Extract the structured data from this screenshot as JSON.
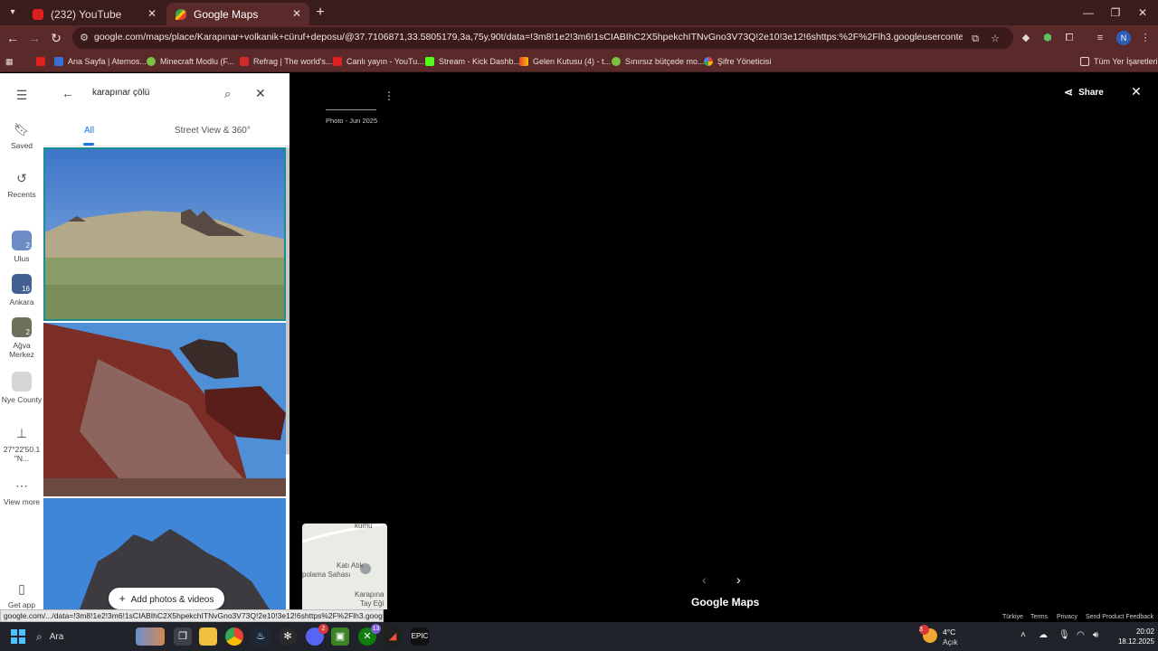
{
  "browser": {
    "tabs": [
      {
        "title": "(232) YouTube",
        "active": false
      },
      {
        "title": "Google Maps",
        "active": true
      }
    ],
    "url": "google.com/maps/place/Karapınar+volkanik+cüruf+deposu/@37.7106871,33.5805179,3a,75y,90t/data=!3m8!1e2!3m6!1sCIABIhC2X5hpekchITNvGno3V73Q!2e10!3e12!6shttps:%2F%2Flh3.googleusercontent.com%2Fgps-cs-s%2FAG...",
    "profile_initial": "N",
    "bookmarks": [
      "Ana Sayfa | Aternos...",
      "Minecraft Modlu (F...",
      "Refrag | The world's...",
      "Canlı yayın - YouTu...",
      "Stream - Kick Dashb...",
      "Gelen Kutusu (4) - t...",
      "Sınırsız bütçede mo...",
      "Şifre Yöneticisi"
    ],
    "all_bookmarks": "Tüm Yer İşaretleri",
    "status_url": "google.com/.../data=!3m8!1e2!3m6!1sCIABIhC2X5hpekchITNvGno3V73Q!2e10!3e12!6shttps%2F%2Flh3.googleuserc..."
  },
  "rail": {
    "saved": "Saved",
    "recents": "Recents",
    "recent_items": [
      {
        "label": "Ulus",
        "count": "2"
      },
      {
        "label": "Ankara",
        "count": "16"
      },
      {
        "label": "Ağva Merkez",
        "count": "2"
      },
      {
        "label": "Nye County",
        "count": ""
      },
      {
        "label": "27°22'50.1 \"N...",
        "count": ""
      }
    ],
    "view_more": "View more",
    "get_app": "Get app"
  },
  "panel": {
    "query": "karapınar çölü",
    "tabs": [
      "All",
      "Street View & 360°"
    ],
    "add_photos": "Add photos & videos"
  },
  "viewer": {
    "photo_date": "Photo - Jun 2025",
    "share": "Share",
    "minimap_labels": [
      "Katı Atık",
      "polama Sahası",
      "Karapına",
      "Tay Eği",
      "kumu"
    ],
    "logo": "Google Maps",
    "footer": [
      "Türkiye",
      "Terms",
      "Privacy",
      "Send Product Feedback"
    ]
  },
  "taskbar": {
    "search": "Ara",
    "temp": "4°C",
    "condition": "Açık",
    "time": "20:02",
    "date": "18.12.2025",
    "weather_badge": "3",
    "discord_badge": "2",
    "xbox_badge": "13"
  }
}
